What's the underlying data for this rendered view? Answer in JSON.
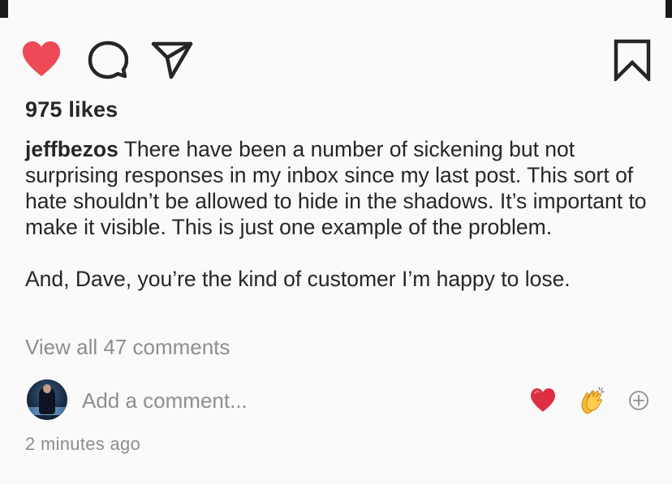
{
  "post": {
    "likes": "975 likes",
    "username": "jeffbezos",
    "caption_first": " There have been a number of sickening but not surprising responses in my inbox since my last post. This sort of hate shouldn’t be allowed to hide in the shadows. It’s important to make it visible. This is just one example of the problem.",
    "caption_second": "And, Dave, you’re the kind of customer I’m happy to lose.",
    "view_all_comments": "View all 47 comments",
    "timestamp": "2 minutes ago"
  },
  "actions": {
    "like_icon": "heart-filled-icon",
    "comment_icon": "comment-bubble-icon",
    "share_icon": "paper-plane-icon",
    "save_icon": "bookmark-icon",
    "like_color": "#ed4956"
  },
  "comment_box": {
    "placeholder": "Add a comment...",
    "quick_reactions": [
      "red-heart-emoji",
      "clapping-hands-emoji"
    ],
    "more_icon": "plus-circle-icon"
  }
}
